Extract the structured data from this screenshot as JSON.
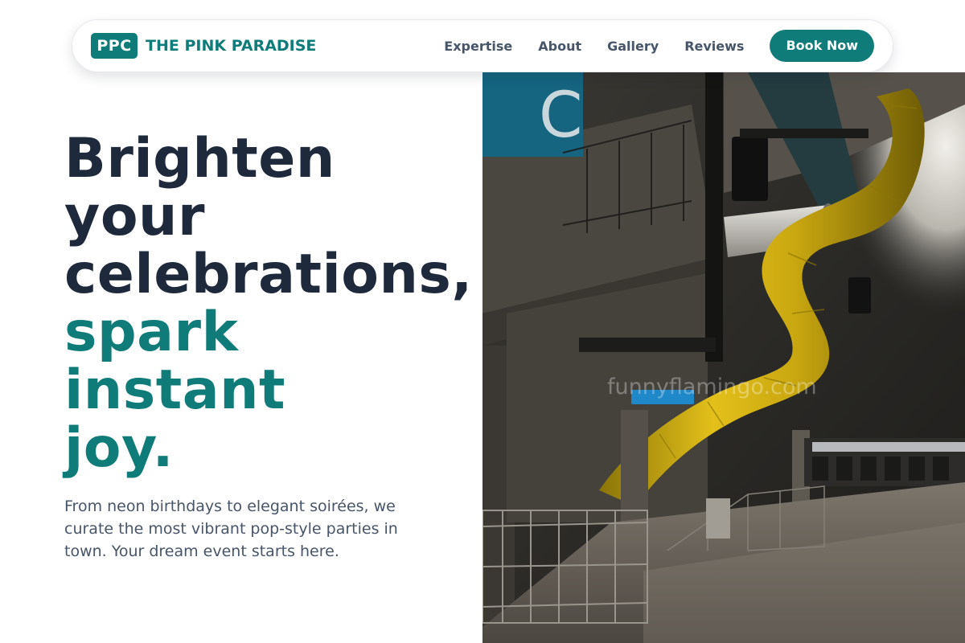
{
  "nav": {
    "logo_badge": "PPC",
    "brand_name": "THE PINK PARADISE",
    "links": [
      "Expertise",
      "About",
      "Gallery",
      "Reviews"
    ],
    "cta_label": "Book Now"
  },
  "hero": {
    "headline_dark": [
      "Brighten",
      "your",
      "celebrations,"
    ],
    "headline_accent": [
      "spark",
      "instant",
      "joy."
    ],
    "subtext": "From neon birthdays to elegant soirées, we curate the most vibrant pop-style parties in town. Your dream event starts here.",
    "image": {
      "description": "Dark underground parking garage with a large yellow tube slide",
      "watermark": "funnyflamingo.com",
      "sign_letter": "C"
    }
  },
  "colors": {
    "brand_teal": "#0f7c7a",
    "headline_dark": "#1e293b",
    "body_text": "#475569",
    "slide_yellow": "#d9b313"
  }
}
